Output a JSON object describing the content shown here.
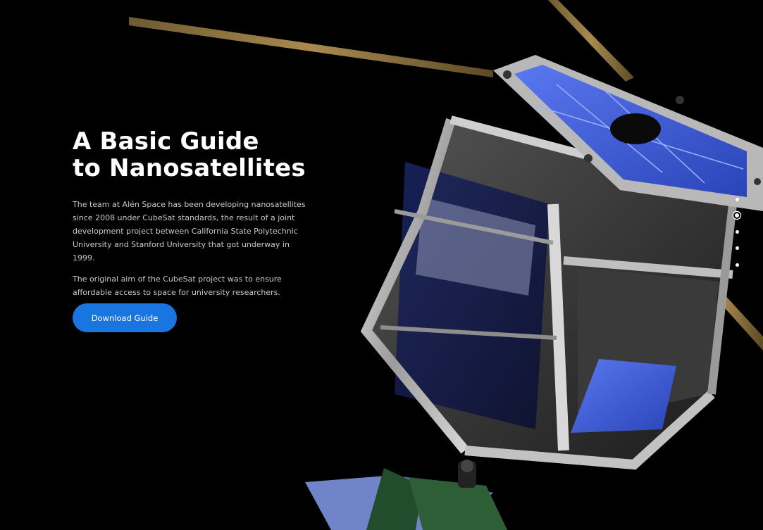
{
  "hero": {
    "title_line1": "A Basic Guide",
    "title_line2": "to Nanosatellites",
    "paragraph1": "The team at Alén Space has been developing nanosatellites since 2008 under CubeSat standards, the result of a joint development project between California State Polytechnic University and Stanford University that got underway in 1999.",
    "paragraph2": "The original aim of the CubeSat project was to ensure affordable access to space for university researchers.",
    "cta_label": "Download Guide"
  },
  "pagination": {
    "total": 5,
    "active_index": 1
  },
  "colors": {
    "background": "#000000",
    "accent": "#1976e0",
    "solar_panel": "#4a67e6"
  }
}
